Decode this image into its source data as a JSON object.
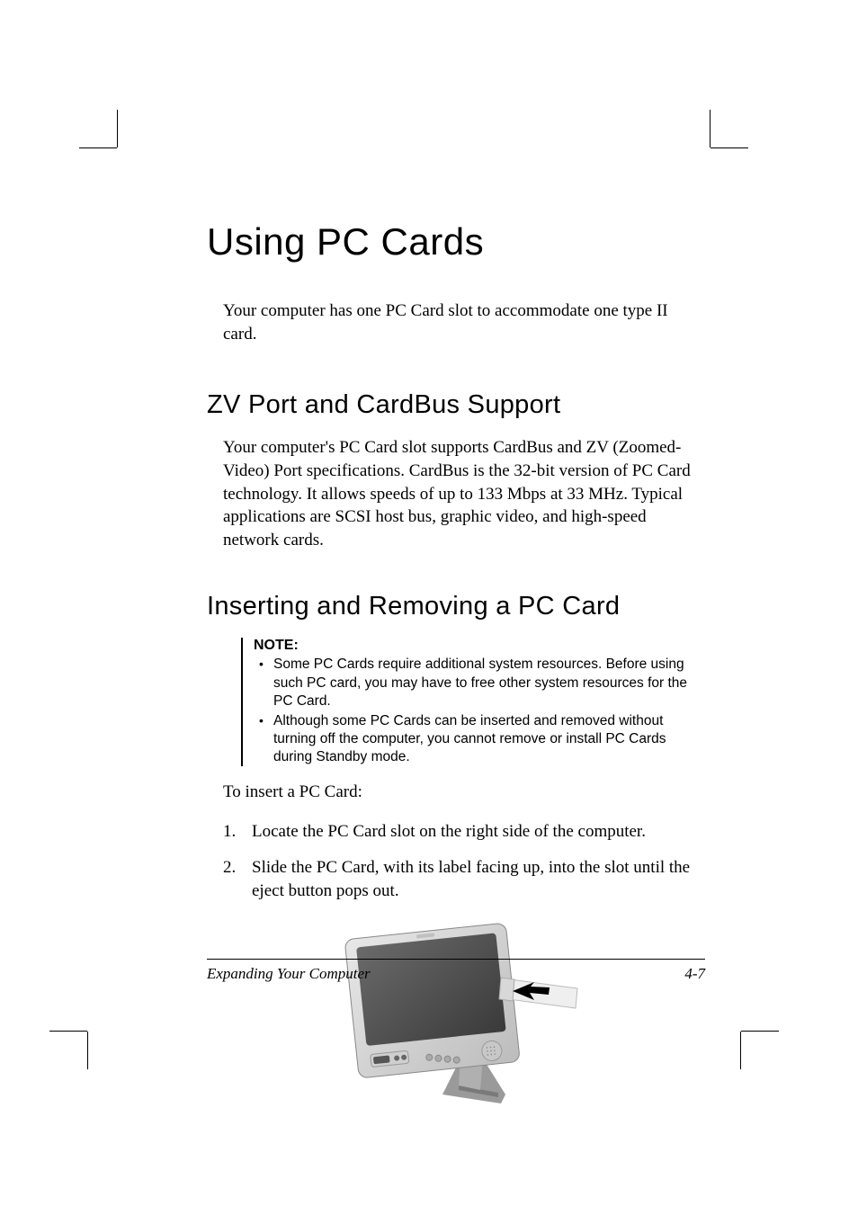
{
  "headings": {
    "h1": "Using PC Cards",
    "h2_zv": "ZV Port and CardBus Support",
    "h2_insert": "Inserting and Removing a PC Card"
  },
  "paragraphs": {
    "intro": "Your computer has one PC Card slot to accommodate one type II card.",
    "zv_body": "Your computer's PC Card slot supports CardBus and ZV (Zoomed-Video) Port specifications. CardBus is the 32-bit version of PC Card technology. It allows speeds of up to 133 Mbps at 33 MHz. Typical applications are SCSI host bus, graphic video, and high-speed network cards.",
    "to_insert": "To insert a PC Card:"
  },
  "note": {
    "label": "NOTE:",
    "items": [
      "Some PC Cards require additional system resources. Before using such PC card, you may have to free other system resources for the PC Card.",
      "Although some PC Cards can be inserted and removed without turning off the computer, you cannot remove or install PC Cards during Standby mode."
    ]
  },
  "steps": [
    {
      "num": "1.",
      "text": "Locate the PC Card slot on the right side of the computer."
    },
    {
      "num": "2.",
      "text": "Slide the PC Card, with its label facing up, into the slot until the eject button pops out."
    }
  ],
  "footer": {
    "left": "Expanding Your Computer",
    "right": "4-7"
  }
}
